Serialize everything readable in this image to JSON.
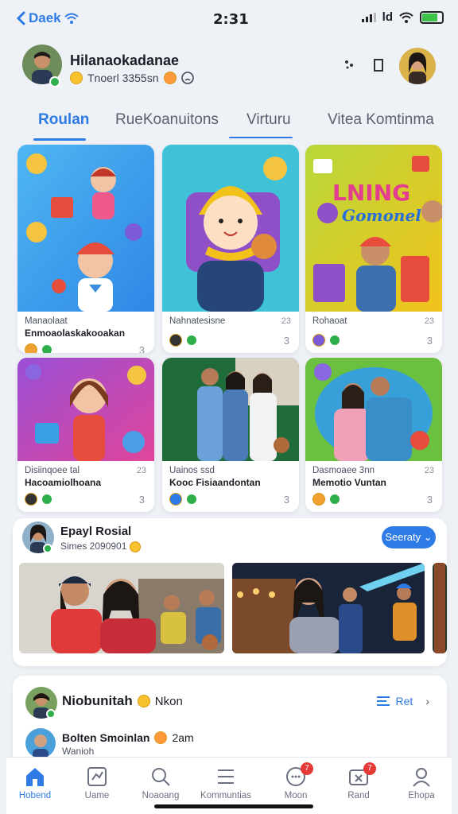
{
  "status": {
    "back_label": "Daek",
    "time": "2:31",
    "network": "ld"
  },
  "header": {
    "name": "Hilanaokadanae",
    "subtitle": "Tnoerl 3355sn"
  },
  "tabs": [
    {
      "label": "Roulan",
      "active": true
    },
    {
      "label": "RueKoanuitons",
      "active": false
    },
    {
      "label": "Virturu",
      "active": false
    },
    {
      "label": "Vitea Komtinma",
      "active": false
    }
  ],
  "cards": [
    {
      "meta": "Manaolaat",
      "title": "Enmoaolaskakooakan",
      "count": "",
      "share": "3"
    },
    {
      "meta": "Nahnatesisne",
      "title": "",
      "count": "23",
      "share": "3"
    },
    {
      "meta": "Rohaoat",
      "title": "",
      "count": "23",
      "share": "3"
    },
    {
      "meta": "Disiinqoee tal",
      "title": "Hacoamiolhoana",
      "count": "23",
      "share": "3"
    },
    {
      "meta": "Uainos ssd",
      "title": "Kooc Fisiaandontan",
      "count": "",
      "share": "3"
    },
    {
      "meta": "Dasmoaee 3nn",
      "title": "Memotio Vuntan",
      "count": "23",
      "share": "3"
    }
  ],
  "card_banner": {
    "line1": "LNING",
    "line2": "Gomonel"
  },
  "social": {
    "title": "Epayl Rosial",
    "subtitle": "Simes 2090901",
    "button": "Seeraty"
  },
  "post": {
    "name": "Niobunitah",
    "time": "Nkon",
    "action": "Ret",
    "reply_name": "Bolten Smoinlan",
    "reply_time": "2am",
    "reply_sub": "Wanioh"
  },
  "nav": [
    {
      "label": "Hobend",
      "active": true,
      "badge": ""
    },
    {
      "label": "Uame",
      "active": false,
      "badge": ""
    },
    {
      "label": "Noaoang",
      "active": false,
      "badge": ""
    },
    {
      "label": "Kommuntias",
      "active": false,
      "badge": ""
    },
    {
      "label": "Moon",
      "active": false,
      "badge": "7"
    },
    {
      "label": "Rand",
      "active": false,
      "badge": "7"
    },
    {
      "label": "Ehopa",
      "active": false,
      "badge": ""
    }
  ]
}
